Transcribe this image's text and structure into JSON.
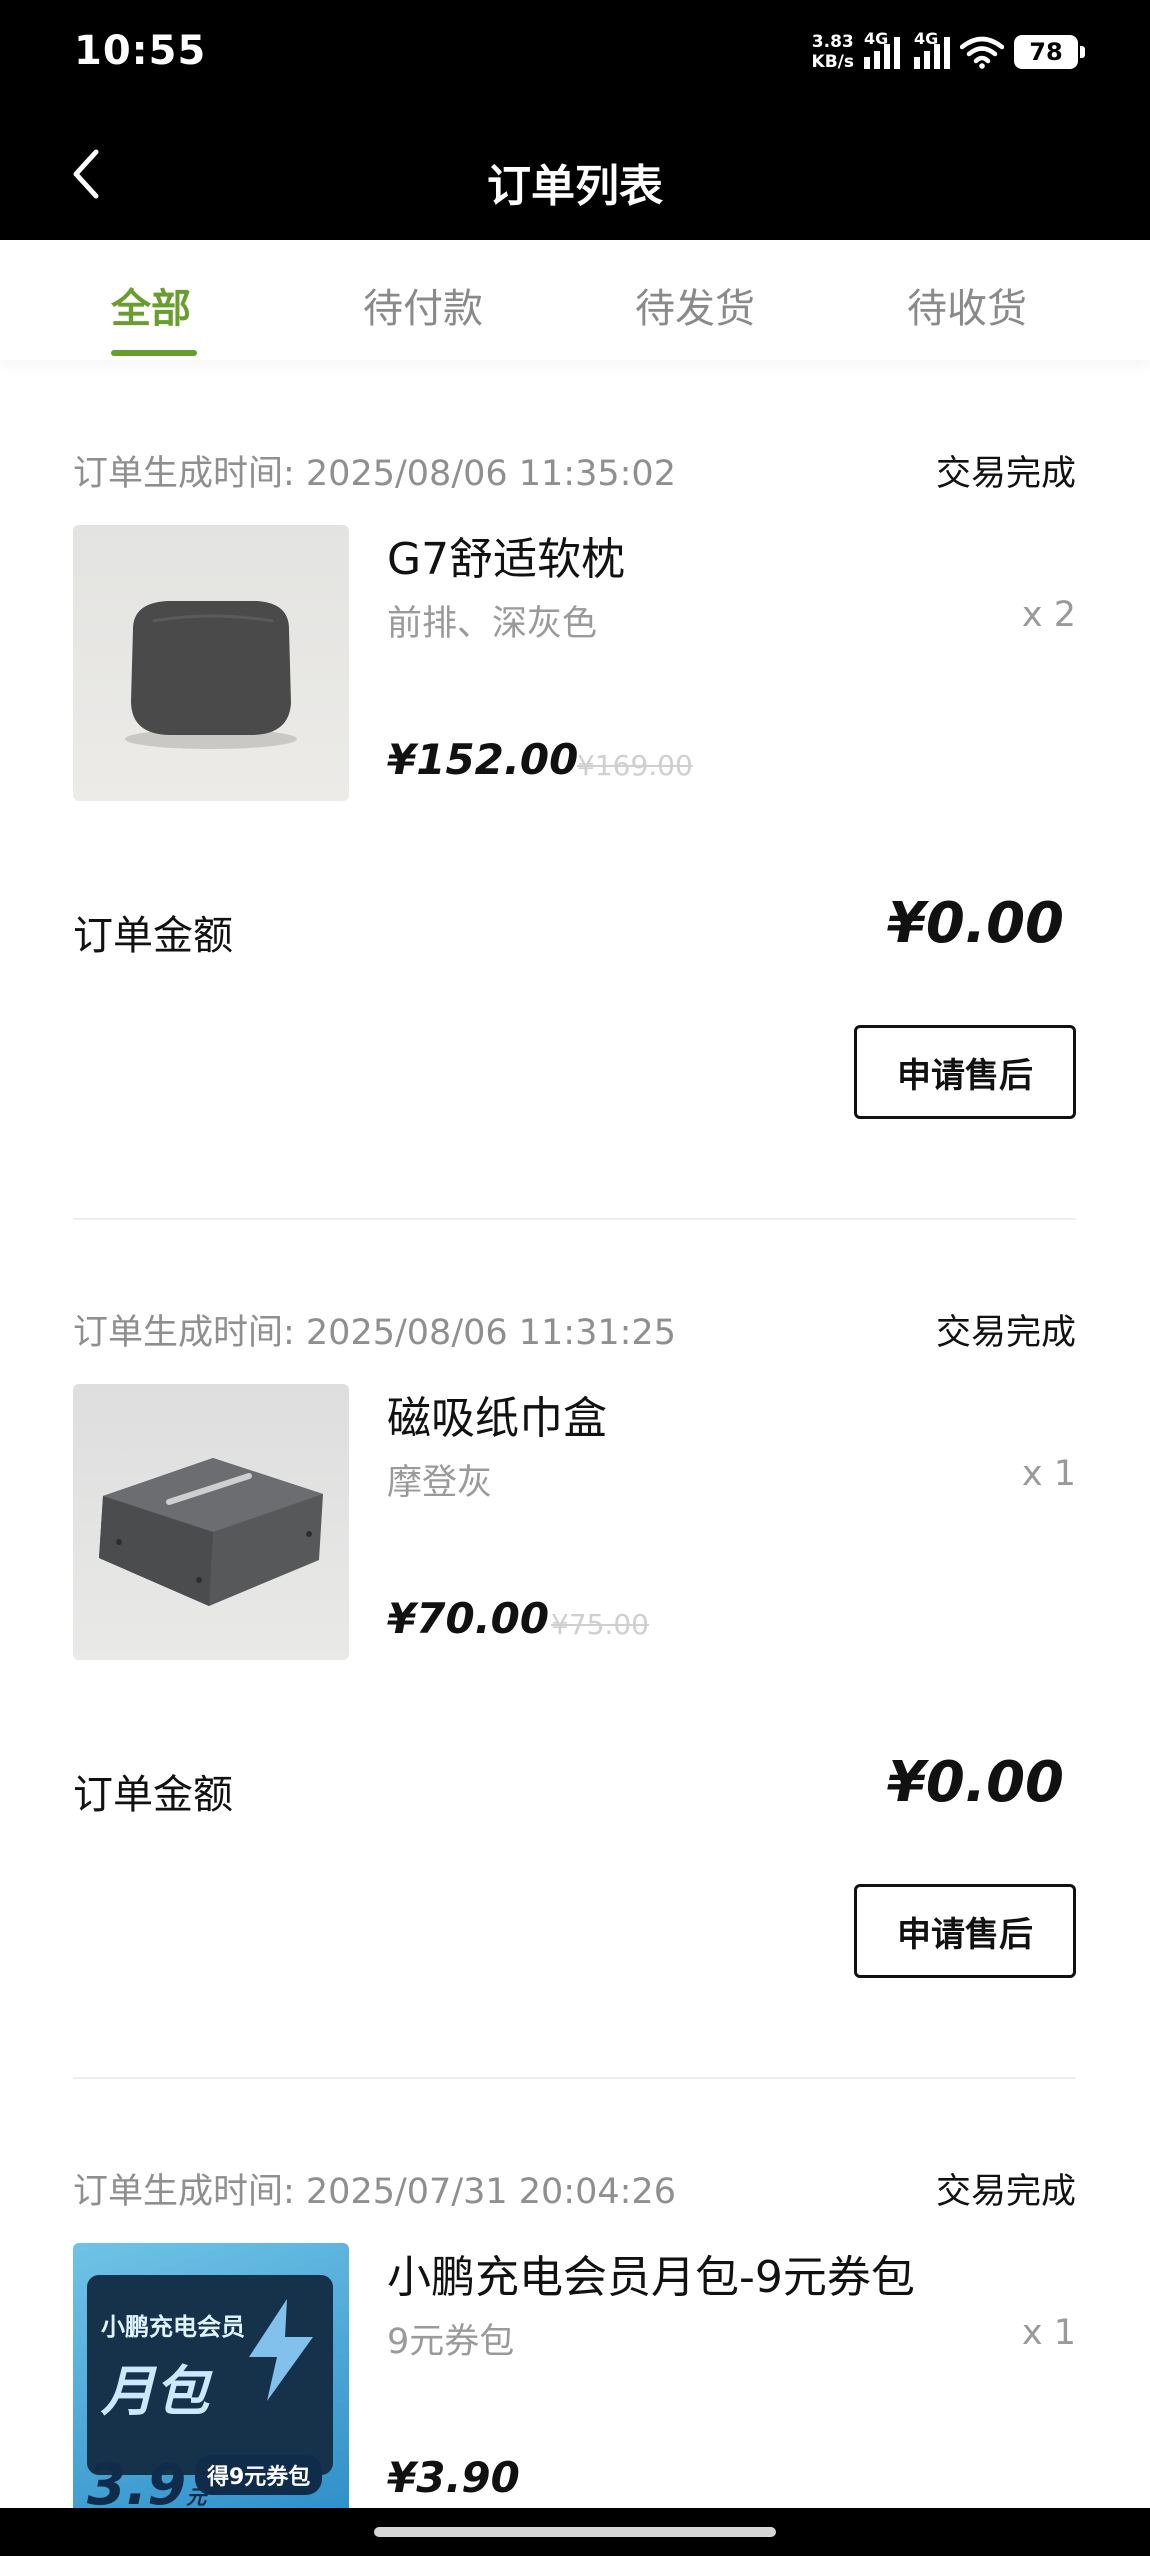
{
  "status_bar": {
    "time": "10:55",
    "net_speed_value": "3.83",
    "net_speed_unit": "KB/s",
    "signal1_label": "4G",
    "signal2_label": "4G",
    "battery": "78"
  },
  "header": {
    "title": "订单列表"
  },
  "tabs": [
    {
      "label": "全部",
      "active": true
    },
    {
      "label": "待付款"
    },
    {
      "label": "待发货"
    },
    {
      "label": "待收货"
    }
  ],
  "orders": [
    {
      "time": "订单生成时间: 2025/08/06 11:35:02",
      "status": "交易完成",
      "product_name": "G7舒适软枕",
      "spec": "前排、深灰色",
      "qty": "x 2",
      "price": "¥152.00",
      "original_price": "¥169.00",
      "amount_label": "订单金额",
      "amount": "¥0.00",
      "action": "申请售后"
    },
    {
      "time": "订单生成时间: 2025/08/06 11:31:25",
      "status": "交易完成",
      "product_name": "磁吸纸巾盒",
      "spec": "摩登灰",
      "qty": "x 1",
      "price": "¥70.00",
      "original_price": "¥75.00",
      "amount_label": "订单金额",
      "amount": "¥0.00",
      "action": "申请售后"
    },
    {
      "time": "订单生成时间: 2025/07/31 20:04:26",
      "status": "交易完成",
      "product_name": "小鹏充电会员月包-9元券包",
      "spec": "9元券包",
      "qty": "x 1",
      "price": "¥3.90",
      "thumb_brand": "小鹏充电会员",
      "thumb_title": "月包",
      "thumb_price": "3.9",
      "thumb_price_unit": "元",
      "thumb_tag": "得9元券包",
      "side_link": "充电VIP主页"
    }
  ],
  "colors": {
    "accent": "#6a9d2f",
    "header_bg": "#000000"
  }
}
